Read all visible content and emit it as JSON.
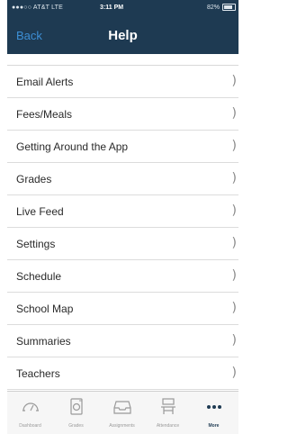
{
  "status_bar": {
    "carrier": "●●●○○ AT&T  LTE",
    "time": "3:11 PM",
    "battery": "82%"
  },
  "nav": {
    "back_label": "Back",
    "title": "Help"
  },
  "list": {
    "items": [
      {
        "label": "Email Alerts"
      },
      {
        "label": "Fees/Meals"
      },
      {
        "label": "Getting Around the App"
      },
      {
        "label": "Grades"
      },
      {
        "label": "Live Feed"
      },
      {
        "label": "Settings"
      },
      {
        "label": "Schedule"
      },
      {
        "label": "School Map"
      },
      {
        "label": "Summaries"
      },
      {
        "label": "Teachers"
      }
    ],
    "chevron": ")"
  },
  "tab_bar": {
    "tabs": [
      {
        "label": "Dashboard",
        "icon": "speedometer-icon"
      },
      {
        "label": "Grades",
        "icon": "grades-icon"
      },
      {
        "label": "Assignments",
        "icon": "inbox-icon"
      },
      {
        "label": "Attendance",
        "icon": "attendance-icon"
      },
      {
        "label": "More",
        "icon": "more-icon",
        "active": true
      }
    ]
  },
  "colors": {
    "nav_background": "#1e3a52",
    "back_link": "#3d8fd6",
    "active_tab": "#1e3a52"
  }
}
